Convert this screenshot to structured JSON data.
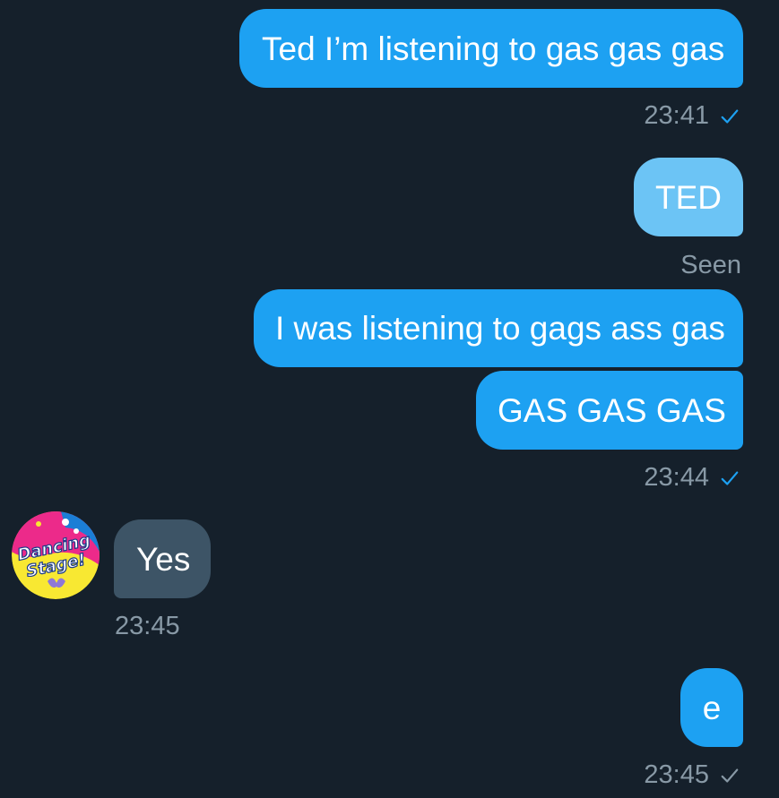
{
  "colors": {
    "background": "#15202b",
    "outgoing_bubble": "#1da1f2",
    "outgoing_bubble_sending": "#6cc4f5",
    "incoming_bubble": "#3d5466",
    "meta_text": "#8899a6",
    "read_check": "#1da1f2"
  },
  "messages": [
    {
      "text": "Ted I’m listening to gas gas gas"
    },
    {
      "text": "TED"
    },
    {
      "text": "I was listening to gags ass gas"
    },
    {
      "text": "GAS GAS GAS"
    },
    {
      "text": "Yes"
    },
    {
      "text": "e"
    }
  ],
  "meta": {
    "m1_time": "23:41",
    "seen_label": "Seen",
    "group_time": "23:44",
    "incoming_time": "23:45",
    "last_time": "23:45"
  },
  "icons": {
    "read_check": "checkmark-icon",
    "sent_check": "checkmark-icon",
    "avatar": "dancing-stage-avatar"
  },
  "avatar": {
    "line1": "Dancing",
    "line2": "Stage!"
  }
}
